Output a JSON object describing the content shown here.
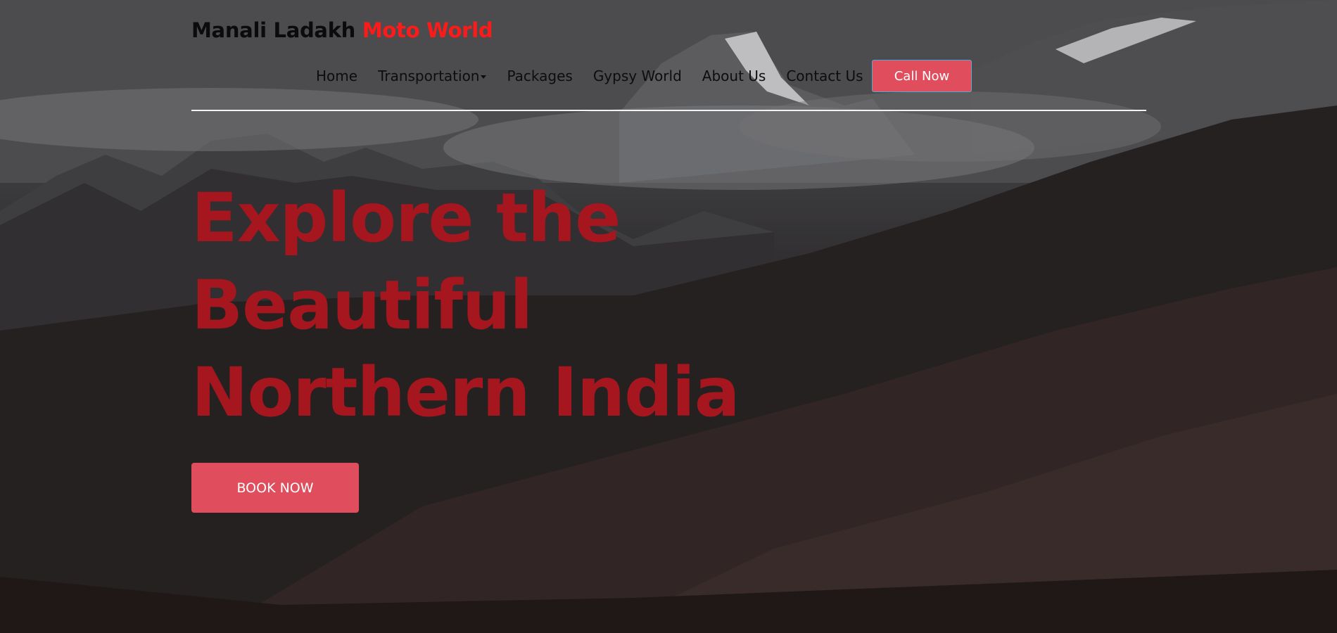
{
  "brand": {
    "name": "Manali Ladakh",
    "accent": "Moto World"
  },
  "nav": {
    "items": [
      {
        "label": "Home"
      },
      {
        "label": "Transportation"
      },
      {
        "label": "Packages"
      },
      {
        "label": "Gypsy World"
      },
      {
        "label": "About Us"
      },
      {
        "label": "Contact Us"
      }
    ],
    "cta_label": "Call Now"
  },
  "hero": {
    "lines": [
      "Explore the",
      "Beautiful",
      "Northern India"
    ],
    "button_label": "BOOK NOW"
  },
  "colors": {
    "accent": "#e04e5e",
    "headline": "#a5161f",
    "brand_accent": "#ff1a1a"
  }
}
